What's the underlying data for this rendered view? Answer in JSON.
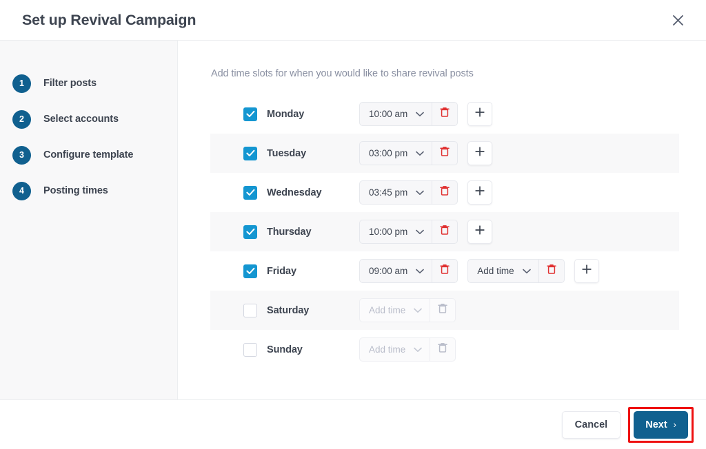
{
  "header": {
    "title": "Set up Revival Campaign",
    "close_icon": "close-icon"
  },
  "sidebar": {
    "steps": [
      {
        "number": "1",
        "label": "Filter posts"
      },
      {
        "number": "2",
        "label": "Select accounts"
      },
      {
        "number": "3",
        "label": "Configure template"
      },
      {
        "number": "4",
        "label": "Posting times"
      }
    ]
  },
  "main": {
    "instruction": "Add time slots for when you would like to share revival posts",
    "add_time_placeholder": "Add time",
    "add_button_label": "+",
    "days": [
      {
        "name": "Monday",
        "checked": true,
        "striped": false,
        "can_add": true,
        "slots": [
          {
            "value": "10:00 am",
            "placeholder": false,
            "disabled": false
          }
        ]
      },
      {
        "name": "Tuesday",
        "checked": true,
        "striped": true,
        "can_add": true,
        "slots": [
          {
            "value": "03:00 pm",
            "placeholder": false,
            "disabled": false
          }
        ]
      },
      {
        "name": "Wednesday",
        "checked": true,
        "striped": false,
        "can_add": true,
        "slots": [
          {
            "value": "03:45 pm",
            "placeholder": false,
            "disabled": false
          }
        ]
      },
      {
        "name": "Thursday",
        "checked": true,
        "striped": true,
        "can_add": true,
        "slots": [
          {
            "value": "10:00 pm",
            "placeholder": false,
            "disabled": false
          }
        ]
      },
      {
        "name": "Friday",
        "checked": true,
        "striped": false,
        "can_add": true,
        "slots": [
          {
            "value": "09:00 am",
            "placeholder": false,
            "disabled": false
          },
          {
            "value": "Add time",
            "placeholder": false,
            "disabled": false
          }
        ]
      },
      {
        "name": "Saturday",
        "checked": false,
        "striped": true,
        "can_add": false,
        "slots": [
          {
            "value": "Add time",
            "placeholder": true,
            "disabled": true
          }
        ]
      },
      {
        "name": "Sunday",
        "checked": false,
        "striped": false,
        "can_add": false,
        "slots": [
          {
            "value": "Add time",
            "placeholder": true,
            "disabled": true
          }
        ]
      }
    ]
  },
  "footer": {
    "cancel_label": "Cancel",
    "next_label": "Next",
    "next_arrow": "›",
    "highlight_color": "#ee1111"
  },
  "colors": {
    "accent_blue": "#10608f",
    "checkbox_blue": "#1496d1",
    "trash_red": "#e03131",
    "text_dark": "#3d4450",
    "text_muted": "#8a90a2",
    "stripe": "#f8f8f9"
  }
}
